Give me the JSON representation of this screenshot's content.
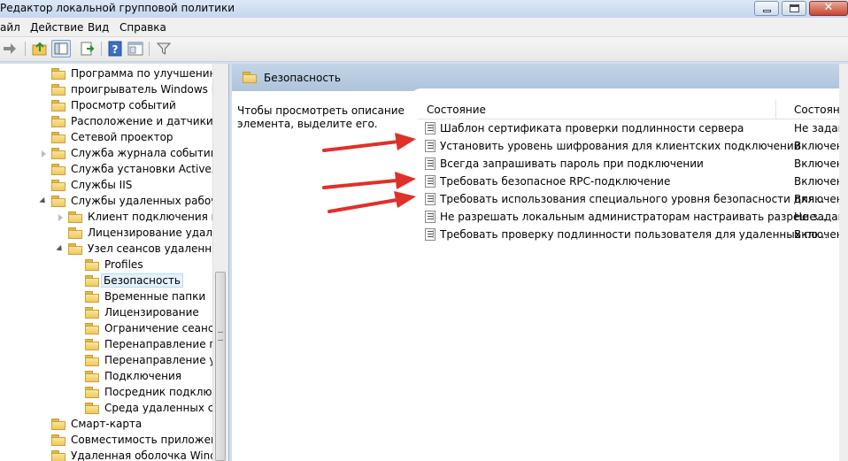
{
  "window": {
    "title": "Редактор локальной групповой политики"
  },
  "menu": {
    "file": "айл",
    "action": "Действие",
    "view": "Вид",
    "help": "Справка"
  },
  "tree": {
    "items": [
      "Программа по улучшению к",
      "проигрыватель Windows Me",
      "Просмотр событий",
      "Расположение и датчики",
      "Сетевой проектор",
      "Служба журнала событий",
      "Служба установки ActiveX",
      "Службы IIS",
      "Службы удаленных рабочих",
      "Клиент подключения к уд",
      "Лицензирование удален",
      "Узел сеансов удаленных р",
      "Profiles",
      "Безопасность",
      "Временные папки",
      "Лицензирование",
      "Ограничение сеансов",
      "Перенаправление при",
      "Перенаправление уст",
      "Подключения",
      "Посредник подключе",
      "Среда удаленных сеан",
      "Смарт-карта",
      "Совместимость приложени",
      "Удаленная оболочка Window"
    ]
  },
  "pane": {
    "title": "Безопасность",
    "description_line1": "Чтобы просмотреть описание",
    "description_line2": "элемента, выделите его.",
    "col_state_name": "Состояние",
    "col_state": "Состояние"
  },
  "policies": [
    {
      "name": "Шаблон сертификата проверки подлинности сервера",
      "state": "Не задан"
    },
    {
      "name": "Установить уровень шифрования для клиентских подключений",
      "state": "Включен"
    },
    {
      "name": "Всегда запрашивать пароль при подключении",
      "state": "Включен"
    },
    {
      "name": "Требовать безопасное RPC-подключение",
      "state": "Включен"
    },
    {
      "name": "Требовать использования специального уровня безопасности для...",
      "state": "Включен"
    },
    {
      "name": "Не разрешать локальным администраторам настраивать разреше...",
      "state": "Не задан"
    },
    {
      "name": "Требовать проверку подлинности пользователя для удаленных по...",
      "state": "Включен"
    }
  ],
  "colors": {
    "arrow": "#e0302a",
    "folder": "#f0c85c",
    "header": "#b4c8de"
  }
}
